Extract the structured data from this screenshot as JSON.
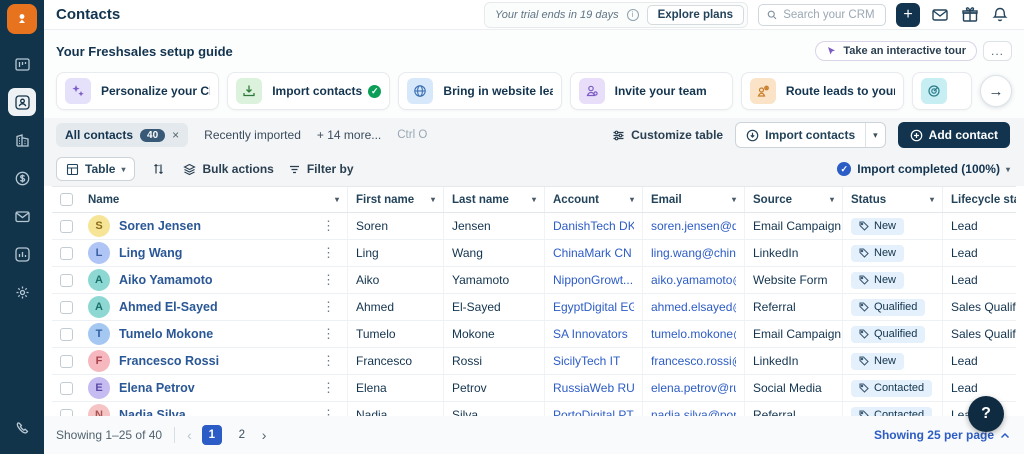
{
  "colors": {
    "accent": "#2c5cc5",
    "navy": "#13344f",
    "logo_orange": "#e8731f",
    "status_pill_bg": "#e4f0fb",
    "done_green": "#0b9e56"
  },
  "header": {
    "title": "Contacts",
    "trial_text": "Your trial ends in 19 days",
    "explore_plans_label": "Explore plans",
    "search_placeholder": "Search your CRM",
    "plus_label": "+"
  },
  "setup": {
    "title": "Your Freshsales setup guide",
    "tour_label": "Take an interactive tour",
    "more_label": "...",
    "cards": [
      {
        "label": "Personalize your CRM",
        "icon_bg": "#e6e1fb"
      },
      {
        "label": "Import contacts",
        "icon_bg": "#ddf2dd",
        "done": true
      },
      {
        "label": "Bring in website leads",
        "icon_bg": "#d8e8fb"
      },
      {
        "label": "Invite your team",
        "icon_bg": "#e9defa"
      },
      {
        "label": "Route leads to your team",
        "icon_bg": "#fbe3c7"
      },
      {
        "label": "",
        "icon_bg": "#c7eef2"
      }
    ],
    "next_arrow": "→"
  },
  "tabs": {
    "active_label": "All contacts",
    "active_count": "40",
    "close": "×",
    "tab2": "Recently imported",
    "tab3": "+ 14 more...",
    "shortcut": "Ctrl O",
    "customize_label": "Customize table",
    "import_label": "Import contacts",
    "add_label": "Add contact"
  },
  "toolbar": {
    "view_label": "Table",
    "bulk_label": "Bulk actions",
    "filter_label": "Filter by",
    "import_status": "Import completed (100%)"
  },
  "table": {
    "columns": [
      "Name",
      "First name",
      "Last name",
      "Account",
      "Email",
      "Source",
      "Status",
      "Lifecycle stage"
    ],
    "rows": [
      {
        "initial": "S",
        "avatar_bg": "#f7e597",
        "avatar_fg": "#8a6d1a",
        "name": "Soren Jensen",
        "first": "Soren",
        "last": "Jensen",
        "account": "DanishTech DK",
        "email": "soren.jensen@dan...",
        "source": "Email Campaign",
        "status": "New",
        "lifecycle": "Lead"
      },
      {
        "initial": "L",
        "avatar_bg": "#afc5f5",
        "avatar_fg": "#3b5fa0",
        "name": "Ling Wang",
        "first": "Ling",
        "last": "Wang",
        "account": "ChinaMark CN",
        "email": "ling.wang@china...",
        "source": "LinkedIn",
        "status": "New",
        "lifecycle": "Lead"
      },
      {
        "initial": "A",
        "avatar_bg": "#8ed8d4",
        "avatar_fg": "#1c6f6a",
        "name": "Aiko Yamamoto",
        "first": "Aiko",
        "last": "Yamamoto",
        "account": "NipponGrowt...",
        "email": "aiko.yamamoto@...",
        "source": "Website Form",
        "status": "New",
        "lifecycle": "Lead"
      },
      {
        "initial": "A",
        "avatar_bg": "#8ed8d4",
        "avatar_fg": "#1c6f6a",
        "name": "Ahmed El-Sayed",
        "first": "Ahmed",
        "last": "El-Sayed",
        "account": "EgyptDigital EG",
        "email": "ahmed.elsayed@e...",
        "source": "Referral",
        "status": "Qualified",
        "lifecycle": "Sales Qualified"
      },
      {
        "initial": "T",
        "avatar_bg": "#a5c8f3",
        "avatar_fg": "#2f5e9e",
        "name": "Tumelo Mokone",
        "first": "Tumelo",
        "last": "Mokone",
        "account": "SA Innovators",
        "email": "tumelo.mokone@...",
        "source": "Email Campaign",
        "status": "Qualified",
        "lifecycle": "Sales Qualified"
      },
      {
        "initial": "F",
        "avatar_bg": "#f6b8be",
        "avatar_fg": "#a8424e",
        "name": "Francesco Rossi",
        "first": "Francesco",
        "last": "Rossi",
        "account": "SicilyTech IT",
        "email": "francesco.rossi@si...",
        "source": "LinkedIn",
        "status": "New",
        "lifecycle": "Lead"
      },
      {
        "initial": "E",
        "avatar_bg": "#c6bcf2",
        "avatar_fg": "#5b4aa5",
        "name": "Elena Petrov",
        "first": "Elena",
        "last": "Petrov",
        "account": "RussiaWeb RU",
        "email": "elena.petrov@russ...",
        "source": "Social Media",
        "status": "Contacted",
        "lifecycle": "Lead"
      },
      {
        "initial": "N",
        "avatar_bg": "#f6c4c4",
        "avatar_fg": "#a85555",
        "name": "Nadia Silva",
        "first": "Nadia",
        "last": "Silva",
        "account": "PortoDigital PT",
        "email": "nadia.silva@port...",
        "source": "Referral",
        "status": "Contacted",
        "lifecycle": "Lead"
      }
    ]
  },
  "footer": {
    "showing": "Showing 1–25 of 40",
    "prev": "‹",
    "next": "›",
    "pages": [
      "1",
      "2"
    ],
    "active_page": "1",
    "per_page": "Showing 25 per page",
    "help": "?"
  }
}
